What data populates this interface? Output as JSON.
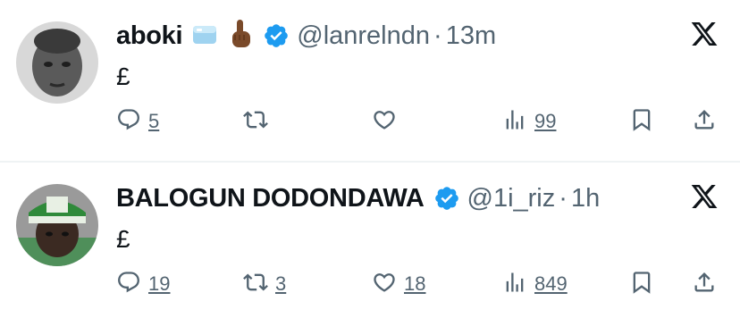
{
  "tweets": [
    {
      "name": "aboki",
      "handle": "@lanrelndn",
      "separator": "·",
      "time": "13m",
      "text": "£",
      "emojis": [
        "ice-cube-icon",
        "pointing-up-icon"
      ],
      "counts": {
        "replies": "5",
        "reposts": "",
        "likes": "",
        "views": "99"
      }
    },
    {
      "name": "BALOGUN DODONDAWA",
      "handle": "@1i_riz",
      "separator": "·",
      "time": "1h",
      "text": "£",
      "emojis": [],
      "counts": {
        "replies": "19",
        "reposts": "3",
        "likes": "18",
        "views": "849"
      }
    }
  ],
  "colors": {
    "verified": "#1d9bf0",
    "secondary_text": "#536471",
    "divider": "#eff3f4"
  }
}
